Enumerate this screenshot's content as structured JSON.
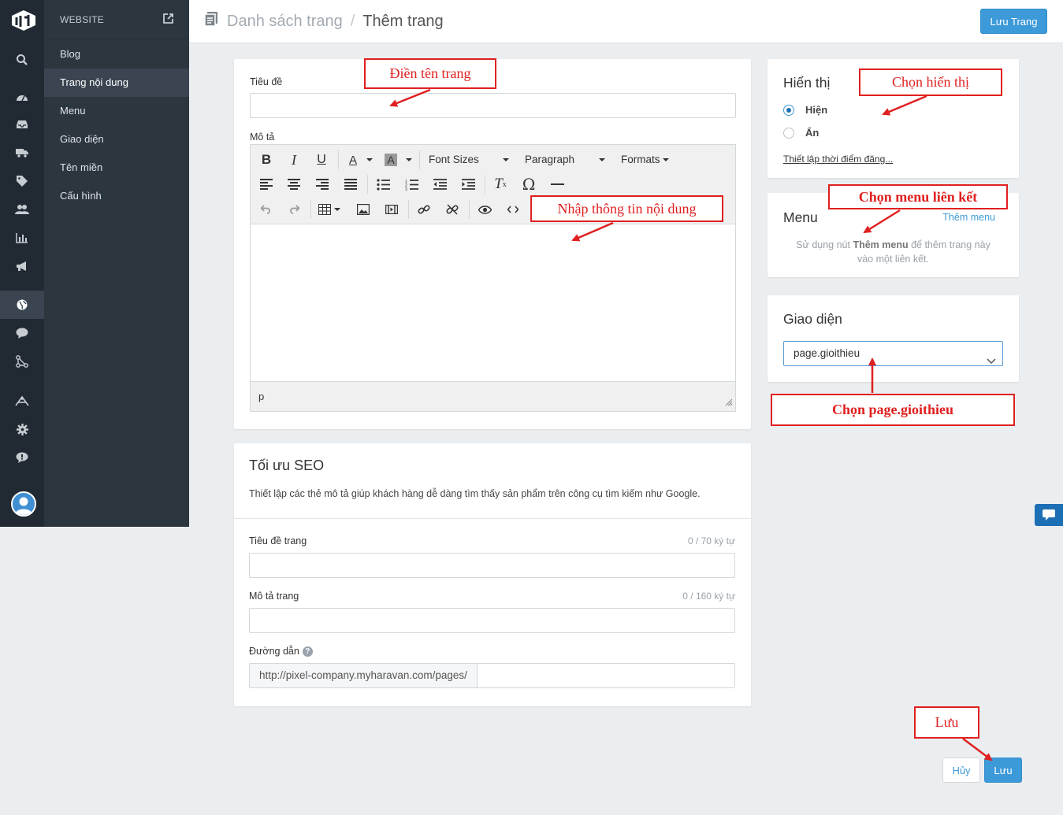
{
  "sidebar": {
    "section_title": "WEBSITE",
    "items": [
      {
        "label": "Blog",
        "active": false
      },
      {
        "label": "Trang nội dung",
        "active": true
      },
      {
        "label": "Menu",
        "active": false
      },
      {
        "label": "Giao diện",
        "active": false
      },
      {
        "label": "Tên miền",
        "active": false
      },
      {
        "label": "Cấu hình",
        "active": false
      }
    ],
    "rail_icons": [
      "search-icon",
      "dashboard-icon",
      "inbox-icon",
      "shipping-icon",
      "tag-icon",
      "customers-icon",
      "reports-icon",
      "promotion-icon",
      "website-icon",
      "chat-icon",
      "apps-icon",
      "tools-icon",
      "settings-icon",
      "help-icon"
    ]
  },
  "header": {
    "breadcrumb_parent": "Danh sách trang",
    "breadcrumb_sep": "/",
    "breadcrumb_current": "Thêm trang",
    "save_label": "Lưu Trang"
  },
  "page_form": {
    "title_label": "Tiêu đề",
    "title_value": "",
    "desc_label": "Mô tả",
    "editor": {
      "font_sizes": "Font Sizes",
      "paragraph": "Paragraph",
      "formats": "Formats",
      "status_path": "p"
    }
  },
  "seo": {
    "heading": "Tối ưu SEO",
    "description": "Thiết lập các thẻ mô tả giúp khách hàng dễ dàng tìm thấy sản phẩm trên công cụ tìm kiếm như Google.",
    "page_title_label": "Tiêu đề trang",
    "page_title_counter": "0 / 70 ký tự",
    "page_desc_label": "Mô tả trang",
    "page_desc_counter": "0 / 160 ký tự",
    "url_label": "Đường dẫn",
    "url_prefix": "http://pixel-company.myharavan.com/pages/",
    "url_value": ""
  },
  "visibility": {
    "heading": "Hiển thị",
    "option_show": "Hiện",
    "option_hide": "Ẩn",
    "selected": "Hiện",
    "schedule_link": "Thiết lập thời điểm đăng..."
  },
  "menu_card": {
    "heading": "Menu",
    "add_link": "Thêm menu",
    "help_prefix": "Sử dụng nút ",
    "help_bold": "Thêm menu",
    "help_suffix": " để thêm trang này",
    "help_line2": "vào một liên kết."
  },
  "template_card": {
    "heading": "Giao diện",
    "selected": "page.gioithieu"
  },
  "footer": {
    "cancel_label": "Hủy",
    "save_label": "Lưu"
  },
  "annotations": {
    "fill_title": "Điền tên trang",
    "enter_content": "Nhập thông tin nội dung",
    "choose_visibility": "Chọn hiển thị",
    "choose_menu": "Chọn menu liên kết",
    "choose_template": "Chọn page.gioithieu",
    "save": "Lưu"
  },
  "colors": {
    "primary": "#3d9ad9",
    "sidebar_dark": "#212a33",
    "sidebar": "#2c363f",
    "annotation": "#e02020"
  }
}
